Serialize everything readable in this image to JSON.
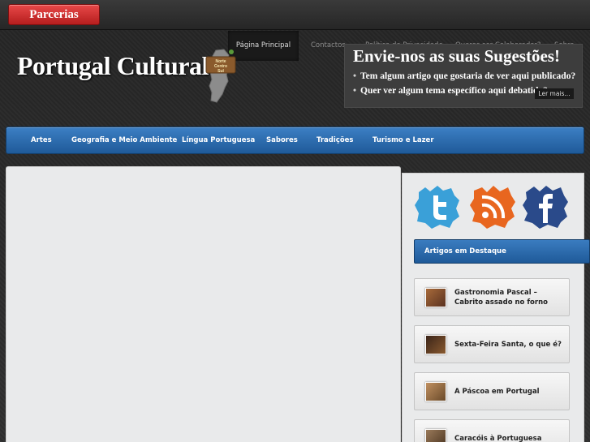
{
  "topbar": {
    "partners_label": "Parcerias"
  },
  "nav": {
    "items": [
      "Página Principal",
      "Contactos",
      "Política de Privacidade",
      "Queres ser Colaborador?",
      "Sobre"
    ]
  },
  "header": {
    "site_title": "Portugal Cultural",
    "map_labels": [
      "Norte",
      "Centro",
      "Sul"
    ]
  },
  "suggestions": {
    "title": "Envie-nos as suas Sugestões!",
    "lines": [
      "Tem algum artigo que gostaria de ver aqui publicado?",
      "Quer ver algum tema específico aqui debatido?"
    ],
    "more_label": "Ler mais..."
  },
  "categories": [
    "Artes",
    "Geografia e Meio Ambiente",
    "Língua Portuguesa",
    "Sabores",
    "Tradições",
    "Turismo e Lazer"
  ],
  "social": [
    "twitter-icon",
    "rss-icon",
    "facebook-icon"
  ],
  "sidebar": {
    "featured_title": "Artigos em Destaque",
    "articles": [
      {
        "title": "Gastronomia Pascal – Cabrito assado no forno",
        "thumb_color": "#7a4a2a"
      },
      {
        "title": "Sexta-Feira Santa, o que é?",
        "thumb_color": "#5a3220"
      },
      {
        "title": "A Páscoa em Portugal",
        "thumb_color": "#8a6a4a"
      },
      {
        "title": "Caracóis à Portuguesa",
        "thumb_color": "#6b5138"
      }
    ]
  },
  "colors": {
    "accent_blue": "#2d6fb2",
    "partners_red": "#d03030"
  }
}
